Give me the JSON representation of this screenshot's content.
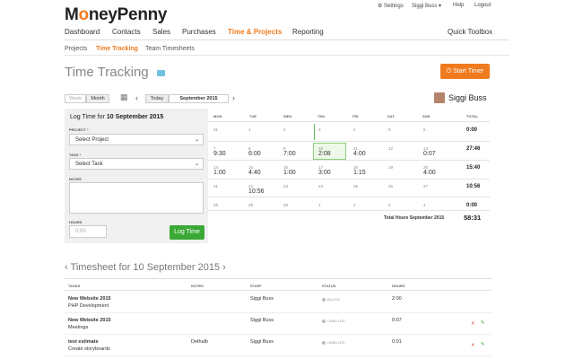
{
  "brand": {
    "prefix": "M",
    "o": "o",
    "suffix": "neyPenny"
  },
  "topmenu": {
    "settings": "⚙ Settings",
    "user": "Siggi Buss ▾",
    "help": "Help",
    "logout": "Logout"
  },
  "mainnav": [
    "Dashboard",
    "Contacts",
    "Sales",
    "Purchases",
    "Time & Projects",
    "Reporting"
  ],
  "quick_toolbox": "Quick Toolbox",
  "subnav": [
    "Projects",
    "Time Tracking",
    "Team Timesheets"
  ],
  "page_title": "Time Tracking",
  "start_timer": "Start Timer",
  "week_label": "Week",
  "month_label": "Month",
  "today_label": "Today",
  "period": "September 2015",
  "current_user": "Siggi Buss",
  "log_title_prefix": "Log Time for ",
  "log_title_date": "10 September 2015",
  "project_label": "PROJECT *",
  "project_value": "Select Project",
  "task_label": "TASK *",
  "task_value": "Select Task",
  "notes_label": "NOTES",
  "hours_label": "HOURS",
  "hours_placeholder": "0:00",
  "log_time_btn": "Log Time",
  "days": [
    "MON",
    "TUE",
    "WED",
    "THU",
    "FRI",
    "SAT",
    "SUN",
    "TOTAL"
  ],
  "weeks": [
    {
      "nums": [
        "31",
        "1",
        "2",
        "3",
        "4",
        "5",
        "6"
      ],
      "hours": [
        "",
        "",
        "",
        "",
        "",
        "",
        ""
      ],
      "total": "0:00"
    },
    {
      "nums": [
        "7",
        "8",
        "9",
        "10",
        "11",
        "12",
        "13"
      ],
      "hours": [
        "9:30",
        "6:00",
        "7:00",
        "2:08",
        "4:00",
        "",
        "0:07"
      ],
      "total": "27:46"
    },
    {
      "nums": [
        "14",
        "15",
        "16",
        "17",
        "18",
        "19",
        "20"
      ],
      "hours": [
        "1:00",
        "4:40",
        "1:00",
        "3:00",
        "1:15",
        "",
        "4:00"
      ],
      "total": "15:40"
    },
    {
      "nums": [
        "21",
        "22",
        "23",
        "24",
        "25",
        "26",
        "27"
      ],
      "hours": [
        "",
        "10:56",
        "",
        "",
        "",
        "",
        ""
      ],
      "total": "10:56"
    },
    {
      "nums": [
        "28",
        "29",
        "30",
        "1",
        "2",
        "3",
        "4"
      ],
      "hours": [
        "",
        "",
        "",
        "",
        "",
        "",
        ""
      ],
      "total": "0:00"
    }
  ],
  "total_label": "Total Hours September 2015",
  "total_value": "58:31",
  "timesheet_title": "Timesheet for 10 September 2015",
  "ts_headers": [
    "TASKS",
    "NOTES",
    "STAFF",
    "STATUS",
    "HOURS"
  ],
  "ts_rows": [
    {
      "project": "New Website 2015",
      "task": "PHP Development",
      "notes": "",
      "staff": "Siggi Buss",
      "status": "BILLED",
      "hours": "2:00"
    },
    {
      "project": "New Website 2015",
      "task": "Meetings",
      "notes": "",
      "staff": "Siggi Buss",
      "status": "UNBILLED",
      "hours": "0:07"
    },
    {
      "project": "test estimate",
      "task": "Create storyboards",
      "notes": "Dethalb",
      "staff": "Siggi Buss",
      "status": "UNBILLED",
      "hours": "0:01"
    }
  ]
}
